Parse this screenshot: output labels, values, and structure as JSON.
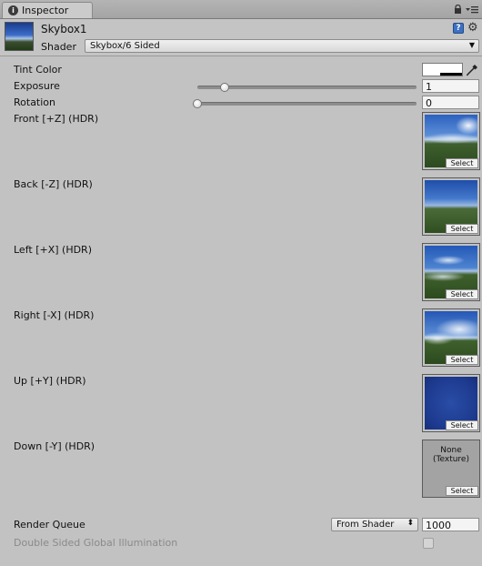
{
  "tab": {
    "label": "Inspector",
    "icon": "info-icon"
  },
  "header": {
    "asset_name": "Skybox1",
    "shader_label": "Shader",
    "shader_value": "Skybox/6 Sided"
  },
  "properties": {
    "tint_color": {
      "label": "Tint Color",
      "value": "#ffffff"
    },
    "exposure": {
      "label": "Exposure",
      "value": "1",
      "slider_fraction": 0.125
    },
    "rotation": {
      "label": "Rotation",
      "value": "0",
      "slider_fraction": 0.0
    }
  },
  "textures": [
    {
      "label": "Front [+Z]   (HDR)",
      "select_label": "Select"
    },
    {
      "label": "Back [-Z]   (HDR)",
      "select_label": "Select"
    },
    {
      "label": "Left [+X]   (HDR)",
      "select_label": "Select"
    },
    {
      "label": "Right [-X]   (HDR)",
      "select_label": "Select"
    },
    {
      "label": "Up [+Y]   (HDR)",
      "select_label": "Select"
    },
    {
      "label": "Down [-Y]   (HDR)",
      "select_label": "Select",
      "none_line1": "None",
      "none_line2": "(Texture)"
    }
  ],
  "render_queue": {
    "label": "Render Queue",
    "mode": "From Shader",
    "value": "1000"
  },
  "double_sided_gi": {
    "label": "Double Sided Global Illumination",
    "checked": false
  }
}
